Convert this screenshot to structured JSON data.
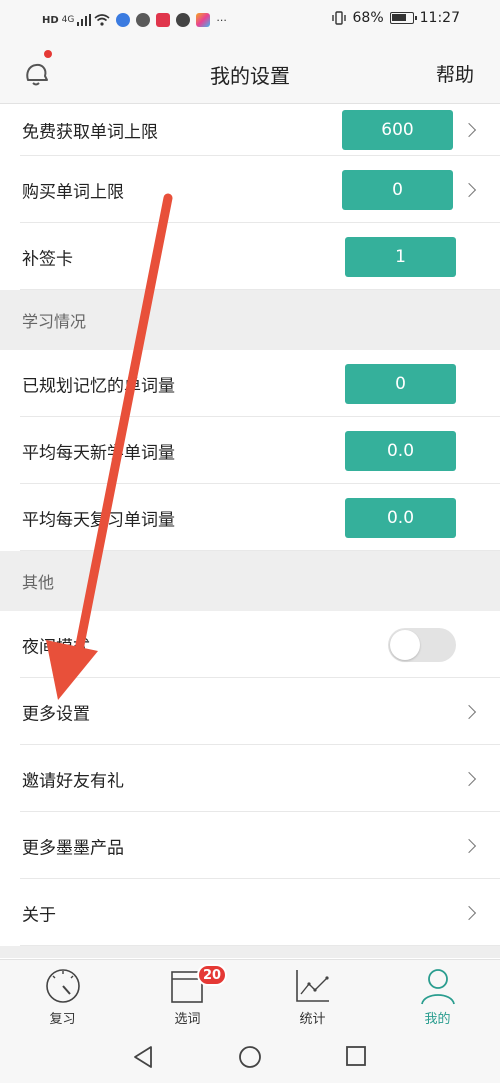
{
  "status_bar": {
    "network": "HD",
    "signal": "4G",
    "more": "···",
    "battery": "68%",
    "time": "11:27"
  },
  "header": {
    "title": "我的设置",
    "help": "帮助"
  },
  "rows_top": [
    {
      "label": "免费获取单词上限",
      "value": "600"
    },
    {
      "label": "购买单词上限",
      "value": "0"
    },
    {
      "label": "补签卡",
      "value": "1"
    }
  ],
  "section_study": "学习情况",
  "rows_study": [
    {
      "label": "已规划记忆的单词量",
      "value": "0"
    },
    {
      "label": "平均每天新学单词量",
      "value": "0.0"
    },
    {
      "label": "平均每天复习单词量",
      "value": "0.0"
    }
  ],
  "section_other": "其他",
  "rows_other": [
    {
      "label": "夜间模式",
      "toggle_on": false
    },
    {
      "label": "更多设置"
    },
    {
      "label": "邀请好友有礼"
    },
    {
      "label": "更多墨墨产品"
    },
    {
      "label": "关于"
    }
  ],
  "tabs": [
    {
      "label": "复习",
      "icon": "review-dial-icon"
    },
    {
      "label": "选词",
      "icon": "calendar-icon",
      "badge": "20"
    },
    {
      "label": "统计",
      "icon": "chart-icon"
    },
    {
      "label": "我的",
      "icon": "person-icon",
      "active": true
    }
  ],
  "colors": {
    "accent": "#35b09b",
    "active_tab": "#2a9d8f",
    "badge": "#e53935",
    "annotation_arrow": "#e8503a"
  }
}
